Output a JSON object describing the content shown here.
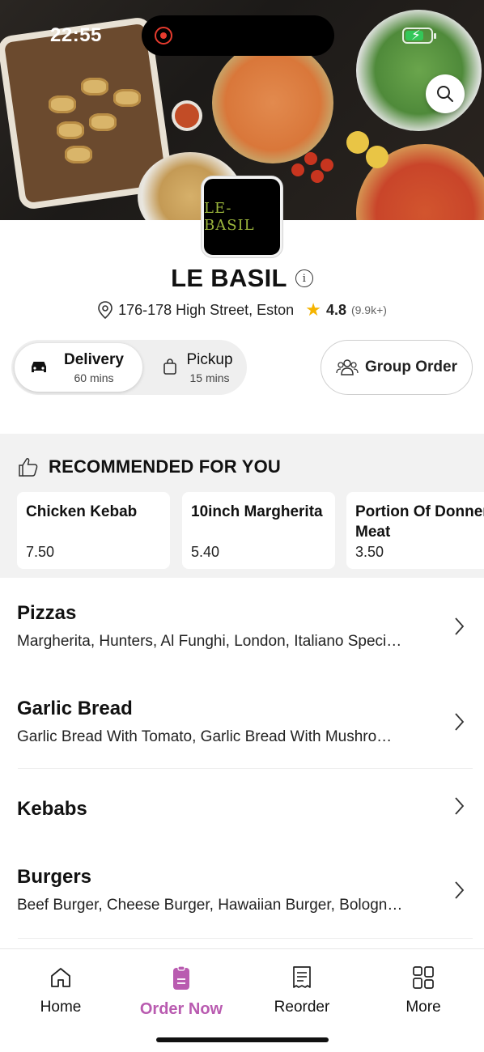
{
  "status_bar": {
    "time": "22:55"
  },
  "hero": {
    "logo_text": "LE-BASIL"
  },
  "restaurant": {
    "name": "LE BASIL",
    "address": "176-178 High Street, Eston",
    "rating": "4.8",
    "rating_count": "(9.9k+)"
  },
  "order_mode": {
    "delivery": {
      "label": "Delivery",
      "time": "60 mins",
      "selected": true
    },
    "pickup": {
      "label": "Pickup",
      "time": "15 mins",
      "selected": false
    }
  },
  "group_order": {
    "label": "Group Order"
  },
  "recommended": {
    "heading": "RECOMMENDED FOR YOU",
    "items": [
      {
        "name": "Chicken Kebab",
        "price": "7.50"
      },
      {
        "name": "10inch Margherita",
        "price": "5.40"
      },
      {
        "name": "Portion Of Donner Meat",
        "price": "3.50"
      }
    ]
  },
  "categories": [
    {
      "name": "Pizzas",
      "description": "Margherita, Hunters, Al Funghi, London, Italiano Speci…"
    },
    {
      "name": "Garlic Bread",
      "description": "Garlic Bread With Tomato, Garlic Bread With Mushro…"
    },
    {
      "name": "Kebabs",
      "description": ""
    },
    {
      "name": "Burgers",
      "description": "Beef Burger, Cheese Burger, Hawaiian Burger, Bologn…"
    }
  ],
  "bottom_nav": {
    "items": [
      {
        "label": "Home",
        "icon": "home-icon"
      },
      {
        "label": "Order Now",
        "icon": "order-icon",
        "active": true
      },
      {
        "label": "Reorder",
        "icon": "receipt-icon"
      },
      {
        "label": "More",
        "icon": "grid-icon"
      }
    ]
  },
  "colors": {
    "accent": "#b95bb0",
    "star": "#f5b400",
    "logo_text": "#9bb53c"
  }
}
